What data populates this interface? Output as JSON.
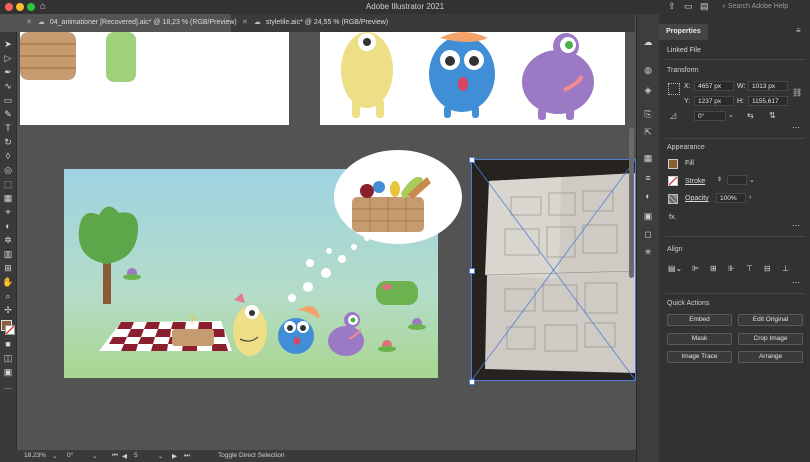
{
  "app": {
    "title": "Adobe Illustrator 2021"
  },
  "search": {
    "placeholder": "Search Adobe Help"
  },
  "tabs": [
    {
      "label": "04_animationer [Recovered].aic* @ 18,23 % (RGB/Preview)"
    },
    {
      "label": "styletile.aic* @ 24,55 % (RGB/Preview)"
    }
  ],
  "status": {
    "zoom": "18,23%",
    "rotation": "0°",
    "artboard": "5",
    "tool_hint": "Toggle Direct Selection"
  },
  "properties": {
    "tab_label": "Properties",
    "object_type": "Linked File",
    "transform": {
      "heading": "Transform",
      "x_label": "X:",
      "x_value": "4657 px",
      "y_label": "Y:",
      "y_value": "1237 px",
      "w_label": "W:",
      "w_value": "1013 px",
      "h_label": "H:",
      "h_value": "1155,617",
      "angle_value": "0°"
    },
    "appearance": {
      "heading": "Appearance",
      "fill_label": "Fill",
      "stroke_label": "Stroke",
      "opacity_label": "Opacity",
      "opacity_value": "100%",
      "fx_label": "fx."
    },
    "align": {
      "heading": "Align"
    },
    "quick_actions": {
      "heading": "Quick Actions",
      "embed": "Embed",
      "edit_original": "Edit Original",
      "mask": "Mask",
      "crop_image": "Crop Image",
      "image_trace": "Image Trace",
      "arrange": "Arrange"
    }
  },
  "colors": {
    "ui_dark": "#323232",
    "canvas": "#535353",
    "selection": "#4f7fd6"
  }
}
